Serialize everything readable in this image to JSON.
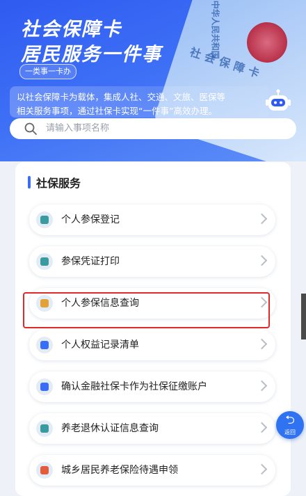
{
  "banner": {
    "title_line1": "社会保障卡",
    "title_line2": "居民服务一件事",
    "tag": "一类事一卡办",
    "description_line1": "以社会保障卡为载体，集成人社、交通、文旅、医保等",
    "description_line2": "相关服务事项，通过社保卡实现“一件事”高效办理。",
    "card_text_country": "中华人民共和国",
    "card_text_name": "社会保障卡"
  },
  "search": {
    "placeholder": "请输入事项名称"
  },
  "section": {
    "title": "社保服务"
  },
  "services": [
    {
      "label": "个人参保登记",
      "icon": "person-register-icon",
      "color": "#3a9aa0"
    },
    {
      "label": "参保凭证打印",
      "icon": "print-certificate-icon",
      "color": "#3a9aa0"
    },
    {
      "label": "个人参保信息查询",
      "icon": "user-search-icon",
      "color": "#e2a23a"
    },
    {
      "label": "个人权益记录清单",
      "icon": "rights-badge-icon",
      "color": "#3b6cf5"
    },
    {
      "label": "确认金融社保卡作为社保征缴账户",
      "icon": "id-card-icon",
      "color": "#3b6cf5"
    },
    {
      "label": "养老退休认证信息查询",
      "icon": "pension-user-icon",
      "color": "#3a9aa0"
    },
    {
      "label": "城乡居民养老保险待遇申领",
      "icon": "document-icon",
      "color": "#e35b3b"
    }
  ],
  "float_button": {
    "label": "返回",
    "arrow": "⮌"
  },
  "colors": {
    "accent": "#3b6cf5",
    "highlight": "#e02a2a"
  }
}
